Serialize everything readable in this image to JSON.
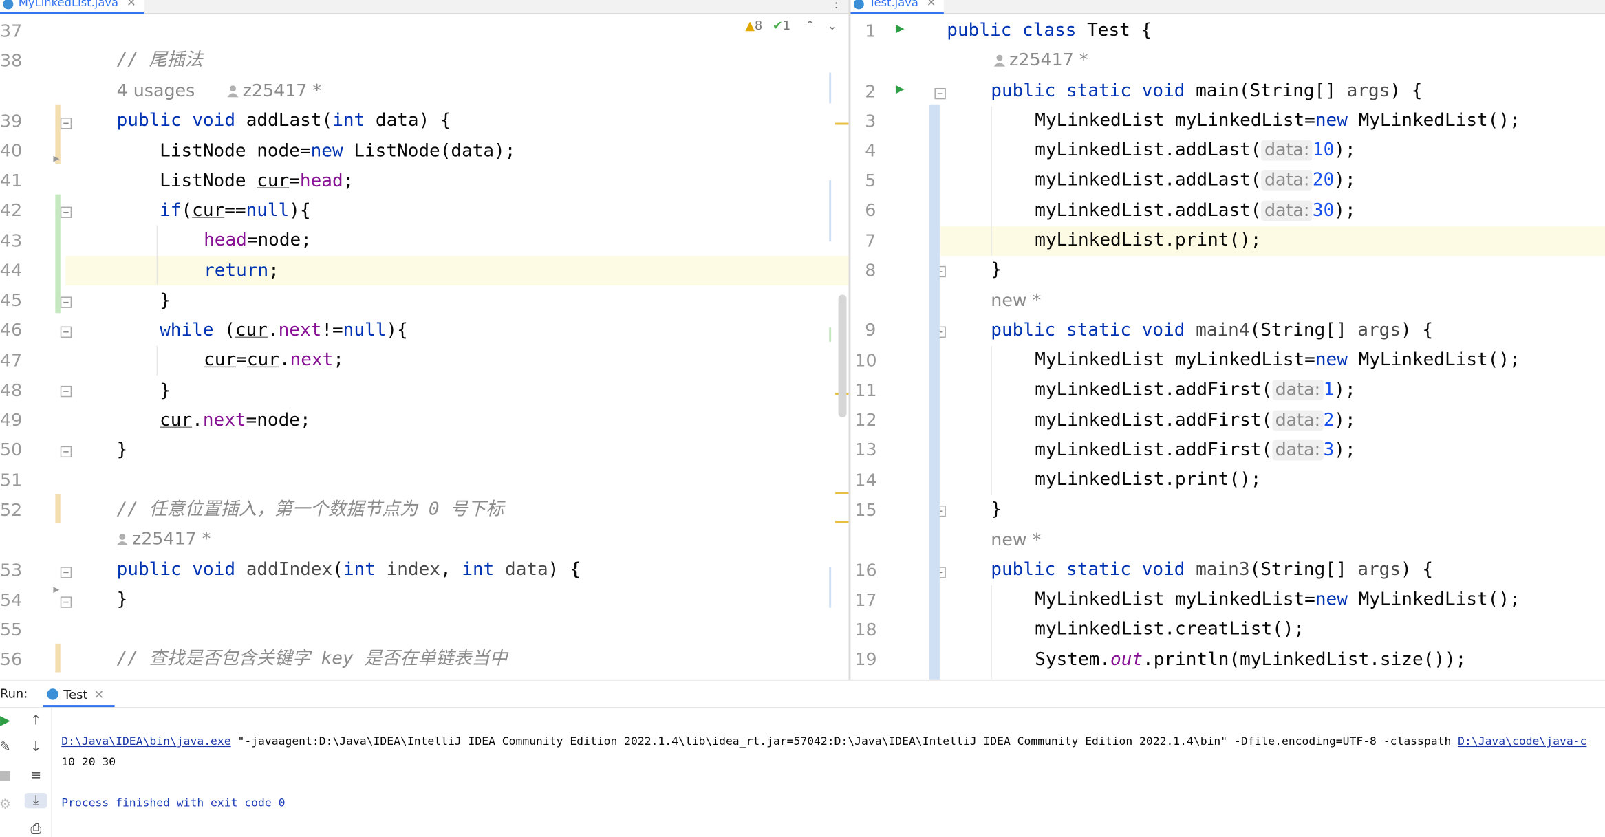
{
  "tabs": {
    "left": {
      "label": "MyLinkedList.java"
    },
    "right": {
      "label": "Test.java"
    }
  },
  "left_editor": {
    "inspection": {
      "warnings": "8",
      "typos": "1"
    },
    "comment_tail": "// 尾插法",
    "usages": "4 usages",
    "author_star": "z25417 *",
    "sig": {
      "kw": "public void ",
      "name": "addLast",
      "p1": "(",
      "ptype": "int",
      "pname": " data",
      "p2": ") {"
    },
    "l41": {
      "a": "ListNode node=",
      "kw": "new",
      "b": " ListNode(data);"
    },
    "l42": {
      "a": "ListNode ",
      "cur": "cur",
      "eq": "=",
      "head": "head",
      "semi": ";"
    },
    "l43": {
      "kw": "if",
      "a": "(",
      "cur": "cur",
      "b": "==",
      "nul": "null",
      "c": "){"
    },
    "l44": {
      "head": "head",
      "a": "=node;"
    },
    "l45": {
      "kw": "return",
      "a": ";"
    },
    "l46": {
      "a": "}"
    },
    "l47": {
      "kw": "while",
      "a": " (",
      "cur": "cur",
      "dot": ".",
      "next": "next",
      "b": "!=",
      "nul": "null",
      "c": "){"
    },
    "l48": {
      "cur1": "cur",
      "a": "=",
      "cur2": "cur",
      "dot": ".",
      "next": "next",
      "semi": ";"
    },
    "l49": {
      "a": "}"
    },
    "l50": {
      "cur": "cur",
      "dot": ".",
      "next": "next",
      "a": "=node;"
    },
    "l51": {
      "a": "}"
    },
    "comment_insert": "// 任意位置插入，第一个数据节点为 0 号下标",
    "author_star2": "z25417 *",
    "sig2": {
      "kw": "public void ",
      "name": "addIndex",
      "a": "(",
      "t1": "int",
      "p1": " index",
      "c": ", ",
      "t2": "int",
      "p2": " data",
      "d": ") {"
    },
    "l55": {
      "a": "}"
    },
    "comment_find": "// 查找是否包含关键字 key 是否在单链表当中",
    "line_numbers": [
      "37",
      "38",
      "",
      "39",
      "40",
      "41",
      "42",
      "43",
      "44",
      "45",
      "46",
      "47",
      "48",
      "49",
      "50",
      "51",
      "52",
      "",
      "53",
      "54",
      "55",
      "56"
    ]
  },
  "right_editor": {
    "line_numbers": [
      "1",
      "",
      "2",
      "3",
      "4",
      "5",
      "6",
      "7",
      "8",
      "",
      "9",
      "10",
      "11",
      "12",
      "13",
      "14",
      "15",
      "",
      "16",
      "17",
      "18",
      "19"
    ],
    "l1": {
      "kw": "public class ",
      "a": "Test {"
    },
    "author1": "z25417 *",
    "l2": {
      "kw": "public static void ",
      "a": "main(String[] ",
      "args": "args",
      "b": ") {"
    },
    "l3": {
      "a": "MyLinkedList myLinkedList=",
      "kw": "new",
      "b": " MyLinkedList();"
    },
    "l4": {
      "a": "myLinkedList.addLast(",
      "hint": "data:",
      "v": "10",
      "b": ");"
    },
    "l5": {
      "a": "myLinkedList.addLast(",
      "hint": "data:",
      "v": "20",
      "b": ");"
    },
    "l6": {
      "a": "myLinkedList.addLast(",
      "hint": "data:",
      "v": "30",
      "b": ");"
    },
    "l7": {
      "a": "myLinkedList.print();"
    },
    "l8": {
      "a": "}"
    },
    "new1": "new *",
    "l9": {
      "kw": "public static void ",
      "name": "main4",
      "a": "(String[] ",
      "args": "args",
      "b": ") {"
    },
    "l10": {
      "a": "MyLinkedList myLinkedList=",
      "kw": "new",
      "b": " MyLinkedList();"
    },
    "l11": {
      "a": "myLinkedList.addFirst(",
      "hint": "data:",
      "v": "1",
      "b": ");"
    },
    "l12": {
      "a": "myLinkedList.addFirst(",
      "hint": "data:",
      "v": "2",
      "b": ");"
    },
    "l13": {
      "a": "myLinkedList.addFirst(",
      "hint": "data:",
      "v": "3",
      "b": ");"
    },
    "l14": {
      "a": "myLinkedList.print();"
    },
    "l15": {
      "a": "}"
    },
    "new2": "new *",
    "l16": {
      "kw": "public static void ",
      "name": "main3",
      "a": "(String[] ",
      "args": "args",
      "b": ") {"
    },
    "l17": {
      "a": "MyLinkedList myLinkedList=",
      "kw": "new",
      "b": " MyLinkedList();"
    },
    "l18": {
      "a": "myLinkedList.creatList();"
    },
    "l19": {
      "a": "System.",
      "out": "out",
      "b": ".println(myLinkedList.size());"
    }
  },
  "run": {
    "label": "Run:",
    "tab": "Test",
    "cmd_link1": "D:\\Java\\IDEA\\bin\\java.exe",
    "cmd_mid": " \"-javaagent:D:\\Java\\IDEA\\IntelliJ IDEA Community Edition 2022.1.4\\lib\\idea_rt.jar=57042:D:\\Java\\IDEA\\IntelliJ IDEA Community Edition 2022.1.4\\bin\" -Dfile.encoding=UTF-8 -classpath ",
    "cmd_link2": "D:\\Java\\code\\java-c",
    "output": "10 20 30",
    "exit": "Process finished with exit code 0"
  },
  "colors": {
    "keyword": "#0033b3",
    "field": "#871094",
    "number": "#1750eb",
    "comment": "#8c8c8c",
    "current_line": "#fdfbe4",
    "accent": "#3574f0"
  }
}
